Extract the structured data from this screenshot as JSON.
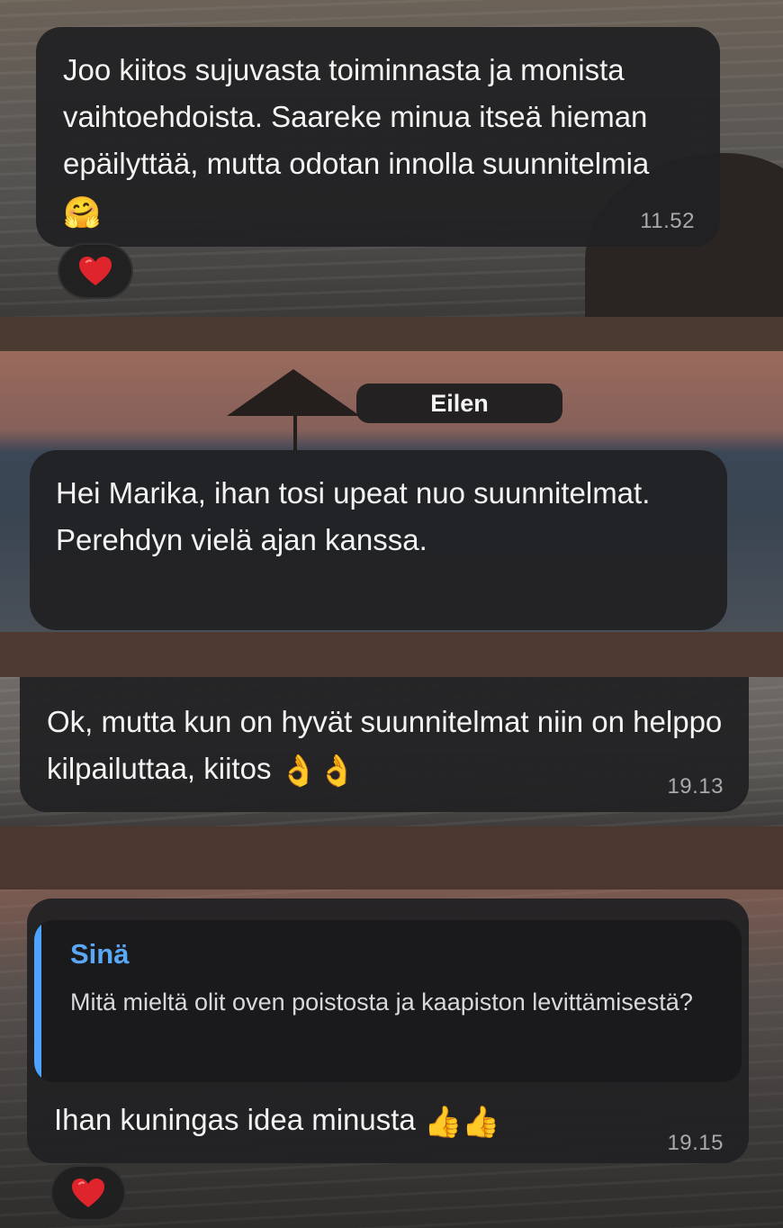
{
  "messages": [
    {
      "text": "Joo kiitos sujuvasta toiminnasta ja monista vaihtoehdoista. Saareke minua itseä hieman epäilyttää, mutta odotan innolla suunnitelmia",
      "emoji": "🤗",
      "time": "11.52",
      "reaction": "❤️"
    },
    {
      "text": "Hei Marika, ihan tosi upeat nuo suunnitelmat. Perehdyn vielä ajan kanssa."
    },
    {
      "text": "Ok, mutta kun on hyvät suunnitelmat niin on helppo kilpailuttaa, kiitos",
      "emoji": "👌👌",
      "time": "19.13"
    },
    {
      "reply_to": {
        "author": "Sinä",
        "text": "Mitä mieltä olit oven poistosta ja kaapiston levittämisestä?"
      },
      "text": "Ihan kuningas idea minusta",
      "emoji": "👍👍",
      "time": "19.15",
      "reaction": "❤️"
    }
  ],
  "date_separator": "Eilen",
  "colors": {
    "bubble": "#212123",
    "quote_accent": "#4da3ff",
    "heart": "#e0242c"
  }
}
